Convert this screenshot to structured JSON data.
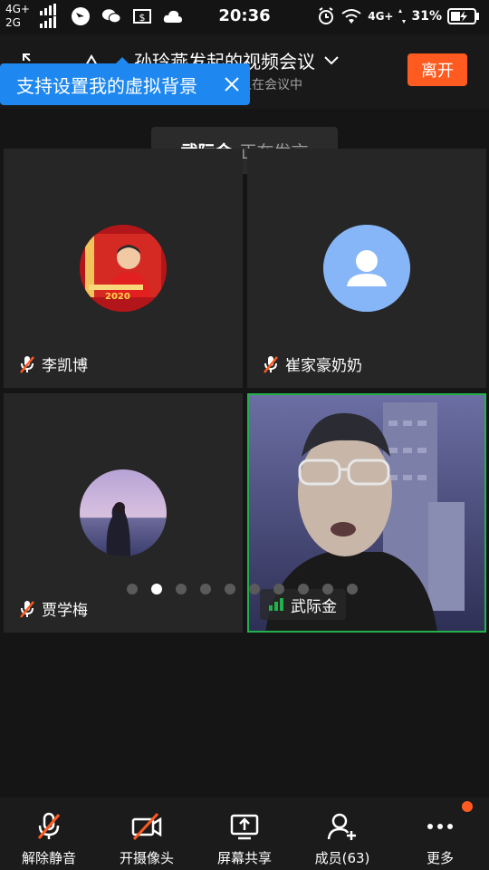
{
  "status_bar": {
    "net_top": "4G+",
    "net_bottom": "2G",
    "time": "20:36",
    "net_right": "4G+",
    "battery": "31%"
  },
  "header": {
    "title": "孙玲燕发起的视频会议",
    "subtitle": "人在会议中",
    "leave_label": "离开"
  },
  "tooltip": {
    "text": "支持设置我的虚拟背景"
  },
  "speaker_banner": {
    "name": "武际金",
    "status": "正在发言"
  },
  "participants": [
    {
      "name": "李凯博",
      "muted": true
    },
    {
      "name": "崔家豪奶奶",
      "muted": true
    },
    {
      "name": "贾学梅",
      "muted": true
    },
    {
      "name": "武际金",
      "muted": false,
      "speaking": true
    }
  ],
  "avatar_badge": "2020",
  "pagination": {
    "total": 10,
    "current": 2
  },
  "toolbar": {
    "unmute": "解除静音",
    "camera": "开摄像头",
    "share": "屏幕共享",
    "members": "成员(63)",
    "more": "更多"
  },
  "colors": {
    "accent": "#ff5a1f",
    "tooltip": "#1e88f0",
    "speaking": "#22b14c"
  }
}
